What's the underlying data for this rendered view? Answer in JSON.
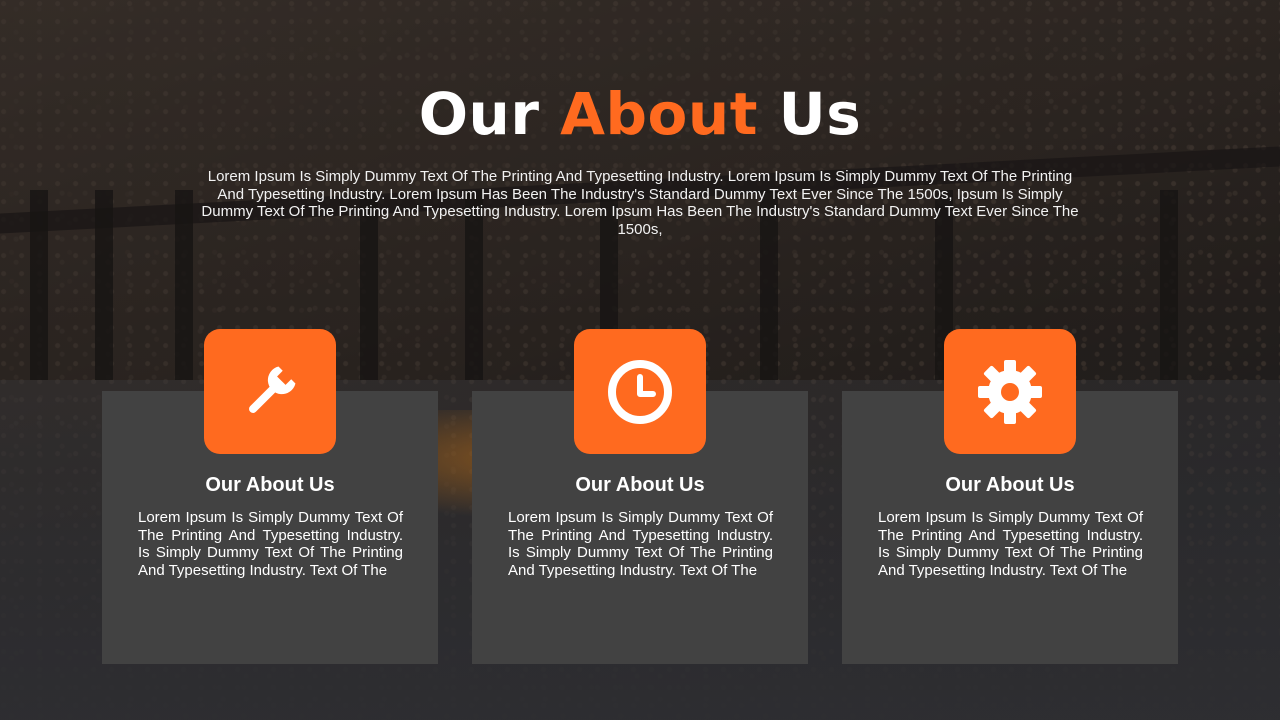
{
  "slide": {
    "title_part1": "Our ",
    "title_accent": "About",
    "title_part2": " Us",
    "intro": "Lorem Ipsum Is Simply Dummy Text Of The Printing And Typesetting Industry. Lorem Ipsum Is Simply Dummy Text Of The Printing And Typesetting Industry. Lorem Ipsum Has Been The Industry's Standard Dummy Text Ever Since The 1500s, Ipsum Is Simply Dummy Text Of The Printing And Typesetting Industry. Lorem Ipsum Has Been The Industry's Standard Dummy Text Ever Since The 1500s,",
    "accent_color": "#ff6a1f"
  },
  "cards": [
    {
      "icon": "wrench-icon",
      "title": "Our About Us",
      "text": "Lorem Ipsum Is Simply Dummy Text Of The Printing And Typesetting Industry.  Is Simply Dummy Text Of The Printing And Typesetting Industry. Text Of The"
    },
    {
      "icon": "clock-icon",
      "title": "Our About Us",
      "text": "Lorem Ipsum Is Simply Dummy Text Of The Printing And Typesetting Industry.  Is Simply Dummy Text Of The Printing And Typesetting Industry. Text Of The"
    },
    {
      "icon": "gear-icon",
      "title": "Our About Us",
      "text": "Lorem Ipsum Is Simply Dummy Text Of The Printing And Typesetting Industry.  Is Simply Dummy Text Of The Printing And Typesetting Industry. Text Of The"
    }
  ]
}
